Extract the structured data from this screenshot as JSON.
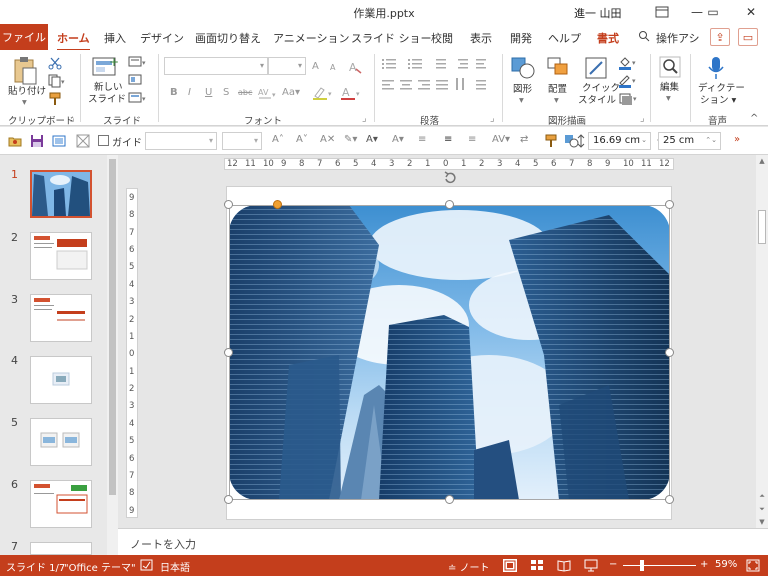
{
  "window": {
    "title": "作業用.pptx",
    "user": "進一 山田",
    "minimize": "—",
    "restore": "▭",
    "close": "✕"
  },
  "tabs": {
    "file": "ファイル",
    "home": "ホーム",
    "insert": "挿入",
    "design": "デザイン",
    "transitions": "画面切り替え",
    "animations": "アニメーション",
    "slideshow": "スライド ショー",
    "review": "校閲",
    "view": "表示",
    "developer": "開発",
    "help": "ヘルプ",
    "format": "書式",
    "search": "操作アシ"
  },
  "ribbon": {
    "clipboard": {
      "label": "クリップボード",
      "paste": "貼り付け"
    },
    "slides": {
      "label": "スライド",
      "new_slide_1": "新しい",
      "new_slide_2": "スライド"
    },
    "font": {
      "label": "フォント",
      "bold": "B",
      "italic": "I",
      "underline": "U",
      "shadow": "S",
      "strike": "abc",
      "grow": "A",
      "shrink": "A",
      "aa": "Aa"
    },
    "paragraph": {
      "label": "段落"
    },
    "drawing": {
      "label": "図形描画",
      "shapes": "図形",
      "arrange": "配置",
      "quick_1": "クイック",
      "quick_2": "スタイル"
    },
    "editing": {
      "label": "編集",
      "edit": "編集"
    },
    "voice": {
      "label": "音声",
      "dictate_1": "ディクテー",
      "dictate_2": "ション"
    },
    "collapse": "^"
  },
  "drawbar": {
    "guide_label": "ガイド",
    "height_value": "16.69 cm",
    "width_value": "25 cm"
  },
  "thumbnails": {
    "numbers": [
      "1",
      "2",
      "3",
      "4",
      "5",
      "6",
      "7"
    ]
  },
  "ruler": {
    "h_ticks": [
      "12",
      "11",
      "10",
      "9",
      "8",
      "7",
      "6",
      "5",
      "4",
      "3",
      "2",
      "1",
      "0",
      "1",
      "2",
      "3",
      "4",
      "5",
      "6",
      "7",
      "8",
      "9",
      "10",
      "11",
      "12"
    ],
    "v_ticks": [
      "9",
      "8",
      "7",
      "6",
      "5",
      "4",
      "3",
      "2",
      "1",
      "0",
      "1",
      "2",
      "3",
      "4",
      "5",
      "6",
      "7",
      "8",
      "9"
    ]
  },
  "notes": {
    "placeholder": "ノートを入力"
  },
  "status": {
    "slide_info": "スライド 1/7",
    "theme": "\"Office テーマ\"",
    "language": "日本語",
    "notes": "ノート",
    "zoom": "59%",
    "minus": "−",
    "plus": "+"
  },
  "colors": {
    "accent": "#c43e1c",
    "statusbar": "#c43e1c",
    "selection_border": "#d35230"
  }
}
